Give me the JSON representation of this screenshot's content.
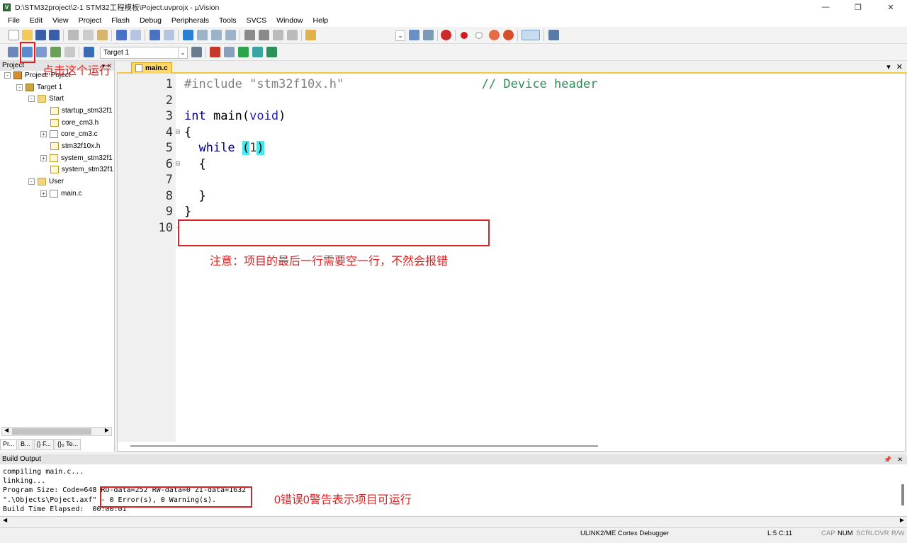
{
  "window": {
    "title": "D:\\STM32project\\2-1 STM32工程模板\\Poject.uvprojx - µVision",
    "minimize": "—",
    "maximize": "❐",
    "close": "✕"
  },
  "menu": [
    "File",
    "Edit",
    "View",
    "Project",
    "Flash",
    "Debug",
    "Peripherals",
    "Tools",
    "SVCS",
    "Window",
    "Help"
  ],
  "toolbar": {
    "target": "Target 1",
    "dropdown_arrow": "⌄"
  },
  "project_panel": {
    "title": "Project",
    "controls": "▾ ✕",
    "tree": [
      {
        "label": "Project: Poject",
        "level": 0,
        "icon": "project-icon",
        "expander": "-"
      },
      {
        "label": "Target 1",
        "level": 1,
        "icon": "target-icon",
        "expander": "-"
      },
      {
        "label": "Start",
        "level": 2,
        "icon": "folder-icon",
        "expander": "-"
      },
      {
        "label": "startup_stm32f1",
        "level": 3,
        "icon": "file-asm-icon",
        "expander": ""
      },
      {
        "label": "core_cm3.h",
        "level": 3,
        "icon": "file-header-icon",
        "expander": ""
      },
      {
        "label": "core_cm3.c",
        "level": 3,
        "icon": "file-c-icon",
        "expander": "+"
      },
      {
        "label": "stm32f10x.h",
        "level": 3,
        "icon": "file-header-icon",
        "expander": ""
      },
      {
        "label": "system_stm32f1",
        "level": 3,
        "icon": "file-c-icon",
        "expander": "+"
      },
      {
        "label": "system_stm32f1",
        "level": 3,
        "icon": "file-header-icon",
        "expander": ""
      },
      {
        "label": "User",
        "level": 2,
        "icon": "folder-icon",
        "expander": "-"
      },
      {
        "label": "main.c",
        "level": 3,
        "icon": "file-c-icon",
        "expander": "+"
      }
    ],
    "bottom_tabs": [
      "Pr...",
      "B...",
      "{} F...",
      "{}₀ Te..."
    ]
  },
  "editor": {
    "tab": "main.c",
    "tab_controls": [
      "▾",
      "✕"
    ],
    "lines": [
      {
        "n": "1",
        "fold": "",
        "html": "<span class=\"pp\">#include</span> <span class=\"str\">\"stm32f10x.h\"</span>                   <span class=\"cmt\">// Device header</span>"
      },
      {
        "n": "2",
        "fold": "",
        "html": ""
      },
      {
        "n": "3",
        "fold": "",
        "html": "<span class=\"kw\">int</span> main(<span class=\"kw2\">void</span>)"
      },
      {
        "n": "4",
        "fold": "⊟",
        "html": "{"
      },
      {
        "n": "5",
        "fold": "",
        "html": "  <span class=\"kw\">while</span> <span class=\"brk\">(</span><span class=\"num\">1</span><span class=\"brk\">)</span>"
      },
      {
        "n": "6",
        "fold": "⊟",
        "html": "  {"
      },
      {
        "n": "7",
        "fold": "",
        "html": ""
      },
      {
        "n": "8",
        "fold": "",
        "html": "  }"
      },
      {
        "n": "9",
        "fold": "",
        "html": "}"
      },
      {
        "n": "10",
        "fold": "-",
        "html": ""
      }
    ]
  },
  "build_output": {
    "title": "Build Output",
    "controls": [
      "📌",
      "✕"
    ],
    "lines": [
      "compiling main.c...",
      "linking...",
      "Program Size: Code=648 RO-data=252 RW-data=0 ZI-data=1632",
      "\".\\Objects\\Poject.axf\" - 0 Error(s), 0 Warning(s).",
      "Build Time Elapsed:  00:00:01"
    ]
  },
  "statusbar": {
    "debugger": "ULINK2/ME Cortex Debugger",
    "position": "L:5 C:11",
    "cap": "CAP",
    "num": "NUM",
    "scrl": "SCRL",
    "ovr": "OVR",
    "rw": "R/W"
  },
  "annotations": {
    "click_run": "点击这个运行",
    "last_line_note": "注意：项目的最后一行需要空一行，不然会报错",
    "errors_note": "0错误0警告表示项目可运行"
  },
  "colors": {
    "annotation_red": "#e02020",
    "keyword_blue": "#00008b",
    "comment_green": "#2e8b57",
    "bracket_highlight": "#46e8ef",
    "tab_yellow": "#ffd866"
  }
}
